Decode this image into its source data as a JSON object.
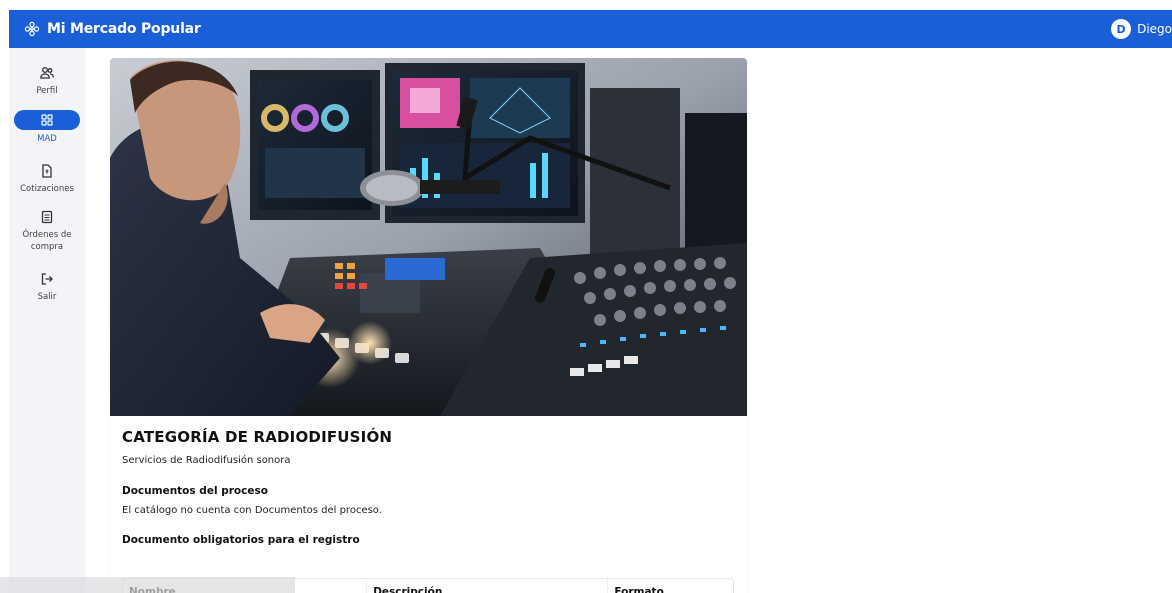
{
  "app": {
    "title": "Mi Mercado Popular"
  },
  "user": {
    "initial": "D",
    "name": "Diego"
  },
  "sidebar": {
    "items": [
      {
        "label": "Perfil",
        "icon": "users-icon",
        "active": false
      },
      {
        "label": "MAD",
        "icon": "grid-icon",
        "active": true
      },
      {
        "label": "Cotizaciones",
        "icon": "document-icon",
        "active": false
      },
      {
        "label": "Órdenes de compra",
        "icon": "receipt-icon",
        "active": false
      },
      {
        "label": "Salir",
        "icon": "logout-icon",
        "active": false
      }
    ]
  },
  "category": {
    "title": "CATEGORÍA DE RADIODIFUSIÓN",
    "subtitle": "Servicios de Radiodifusión sonora",
    "docs_title": "Documentos del proceso",
    "docs_text": "El catálogo no cuenta con Documentos del proceso.",
    "required_title": "Documento obligatorios para el registro",
    "table": {
      "columns": [
        "Nombre",
        "Descripción",
        "Formato"
      ]
    }
  },
  "colors": {
    "primary": "#1a5fd7",
    "sidebar_bg": "#f3f4f8"
  }
}
